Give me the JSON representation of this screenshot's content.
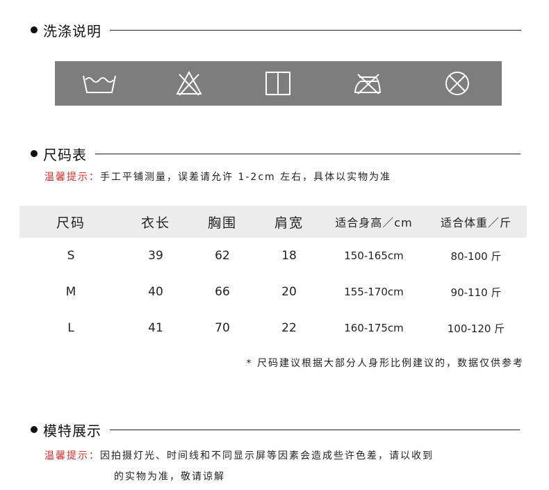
{
  "washing": {
    "title": "洗涤说明",
    "icons": [
      "wash-basin-icon",
      "no-bleach-icon",
      "line-dry-icon",
      "no-iron-icon",
      "no-tumble-dry-icon"
    ]
  },
  "size_chart": {
    "title": "尺码表",
    "tip_label": "温馨提示：",
    "tip_text": "手工平铺测量，误差请允许 1-2cm 左右，具体以实物为准",
    "headers": [
      "尺码",
      "衣长",
      "胸围",
      "肩宽",
      "适合身高／cm",
      "适合体重／斤"
    ],
    "rows": [
      [
        "S",
        "39",
        "62",
        "18",
        "150-165cm",
        "80-100 斤"
      ],
      [
        "M",
        "40",
        "66",
        "20",
        "155-170cm",
        "90-110 斤"
      ],
      [
        "L",
        "41",
        "70",
        "22",
        "160-175cm",
        "100-120 斤"
      ]
    ],
    "note": "* 尺码建议根据大部分人身形比例建议的，数据仅供参考"
  },
  "model_show": {
    "title": "模特展示",
    "tip_label": "温馨提示：",
    "tip_line1": "因拍摄灯光、时间线和不同显示屏等因素会造成些许色差，请以收到",
    "tip_line2": "的实物为准，敬请谅解"
  }
}
